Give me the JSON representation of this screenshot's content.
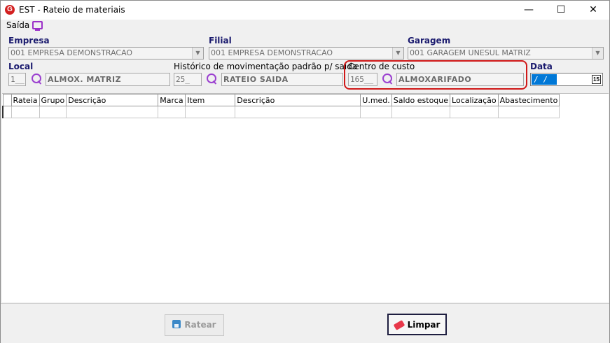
{
  "window": {
    "title": "EST - Rateio de materiais",
    "app_icon_letter": "G",
    "controls": {
      "minimize": "—",
      "maximize": "☐",
      "close": "✕"
    }
  },
  "menu": {
    "saida": "Saída",
    "saida_icon": "monitor-icon"
  },
  "empresa": {
    "label": "Empresa",
    "value": "001 EMPRESA DEMONSTRACAO"
  },
  "filial": {
    "label": "Filial",
    "value": "001 EMPRESA DEMONSTRACAO"
  },
  "garagem": {
    "label": "Garagem",
    "value": "001 GARAGEM UNESUL MATRIZ"
  },
  "local": {
    "label": "Local",
    "code": "1__",
    "description": "ALMOX. MATRIZ"
  },
  "historico": {
    "label": "Histórico de movimentação padrão p/ saída",
    "code": "25_",
    "description": "RATEIO SAIDA"
  },
  "centro_custo": {
    "label": "Centro de custo",
    "code": "165__",
    "description": "ALMOXARIFADO",
    "highlight_color": "#d01818"
  },
  "data": {
    "label": "Data",
    "value": " / /",
    "calendar_icon_text": "15"
  },
  "grid": {
    "columns": [
      "Rateia",
      "Grupo",
      "Descrição",
      "Marca",
      "Item",
      "Descrição",
      "U.med.",
      "Saldo estoque",
      "Localização",
      "Abastecimento"
    ],
    "rows": []
  },
  "buttons": {
    "ratear": {
      "label": "Ratear",
      "icon": "floppy-icon",
      "enabled": false
    },
    "limpar": {
      "label": "Limpar",
      "icon": "eraser-icon",
      "enabled": true
    }
  }
}
